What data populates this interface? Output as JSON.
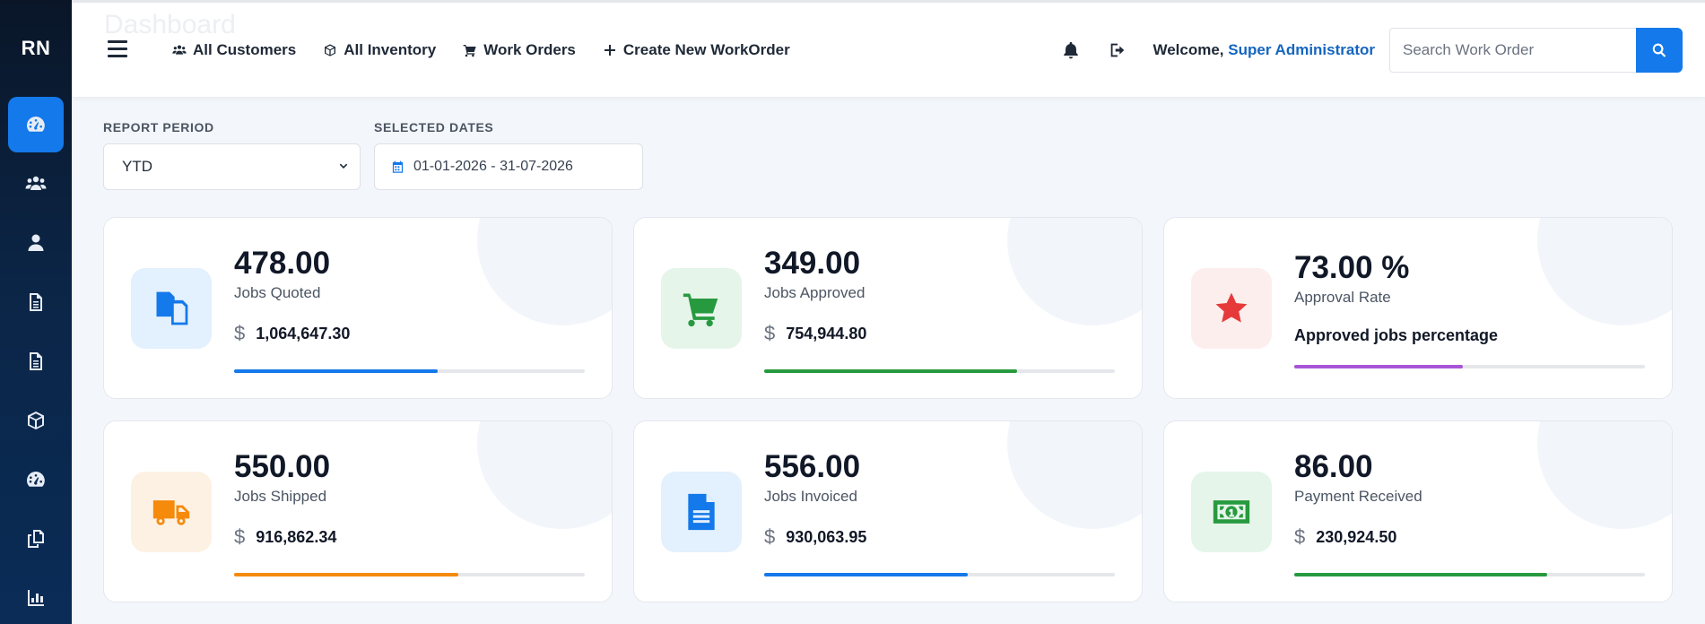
{
  "brand": "RN",
  "sidebar": {
    "items": [
      {
        "icon": "gauge-icon",
        "active": true
      },
      {
        "icon": "users-icon",
        "active": false
      },
      {
        "icon": "user-icon",
        "active": false
      },
      {
        "icon": "document-icon",
        "active": false
      },
      {
        "icon": "document-alt-icon",
        "active": false
      },
      {
        "icon": "box-icon",
        "active": false
      },
      {
        "icon": "palette-icon",
        "active": false
      },
      {
        "icon": "copy-icon",
        "active": false
      },
      {
        "icon": "bar-chart-icon",
        "active": false
      }
    ]
  },
  "header": {
    "ghost_title": "Dashboard",
    "nav": [
      {
        "label": "All Customers",
        "icon": "users-icon"
      },
      {
        "label": "All Inventory",
        "icon": "box-icon"
      },
      {
        "label": "Work Orders",
        "icon": "cart-icon"
      },
      {
        "label": "Create New WorkOrder",
        "icon": "plus-icon"
      }
    ],
    "welcome_prefix": "Welcome, ",
    "user_name": "Super Administrator",
    "search_placeholder": "Search Work Order"
  },
  "filters": {
    "period_label": "REPORT PERIOD",
    "period_value": "YTD",
    "dates_label": "SELECTED DATES",
    "dates_value": "01-01-2026 - 31-07-2026"
  },
  "cards": [
    {
      "value": "478.00",
      "label": "Jobs Quoted",
      "currency": "$",
      "amount": "1,064,647.30",
      "icon": "documents-icon",
      "tile_bg": "#e3f0fd",
      "icon_color": "#1479ea",
      "bar_color": "#1479ea",
      "progress": 0.58
    },
    {
      "value": "349.00",
      "label": "Jobs Approved",
      "currency": "$",
      "amount": "754,944.80",
      "icon": "cart-icon",
      "tile_bg": "#e6f5ea",
      "icon_color": "#279a3f",
      "bar_color": "#279a3f",
      "progress": 0.72
    },
    {
      "value": "73.00 %",
      "label": "Approval Rate",
      "note": "Approved jobs percentage",
      "icon": "star-icon",
      "tile_bg": "#fdeeee",
      "icon_color": "#e63a3a",
      "bar_color": "#a855d6",
      "progress": 0.48
    },
    {
      "value": "550.00",
      "label": "Jobs Shipped",
      "currency": "$",
      "amount": "916,862.34",
      "icon": "truck-icon",
      "tile_bg": "#fdf1e4",
      "icon_color": "#f58a0b",
      "bar_color": "#f58a0b",
      "progress": 0.64
    },
    {
      "value": "556.00",
      "label": "Jobs Invoiced",
      "currency": "$",
      "amount": "930,063.95",
      "icon": "file-icon",
      "tile_bg": "#e3f0fd",
      "icon_color": "#1479ea",
      "bar_color": "#1479ea",
      "progress": 0.58
    },
    {
      "value": "86.00",
      "label": "Payment Received",
      "currency": "$",
      "amount": "230,924.50",
      "icon": "money-icon",
      "tile_bg": "#e6f5ea",
      "icon_color": "#279a3f",
      "bar_color": "#279a3f",
      "progress": 0.72
    }
  ]
}
